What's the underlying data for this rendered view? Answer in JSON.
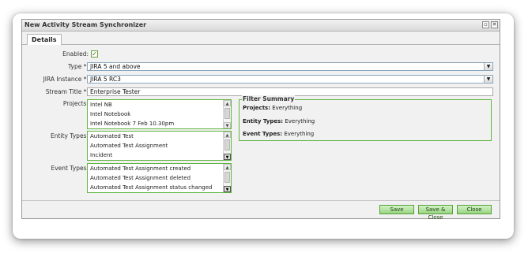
{
  "window": {
    "title": "New Activity Stream Synchronizer",
    "restore_icon": "restore-icon",
    "close_icon": "close-icon"
  },
  "tabs": [
    {
      "label": "Details",
      "active": true
    }
  ],
  "form": {
    "enabled": {
      "label": "Enabled:",
      "checked": true,
      "check_glyph": "✓"
    },
    "type": {
      "label": "Type *:",
      "value": "JIRA 5 and above"
    },
    "jira_instance": {
      "label": "JIRA Instance *:",
      "value": "JIRA 5 RC3"
    },
    "stream_title": {
      "label": "Stream Title *:",
      "value": "Enterprise Tester"
    },
    "projects": {
      "label": "Projects:",
      "items": [
        "Intel NB",
        "Intel Notebook",
        "Intel Notebook 7 Feb 10.30pm"
      ]
    },
    "entity_types": {
      "label": "Entity Types:",
      "items": [
        "Automated Test",
        "Automated Test Assignment",
        "Incident"
      ]
    },
    "event_types": {
      "label": "Event Types:",
      "items": [
        "Automated Test Assignment created",
        "Automated Test Assignment deleted",
        "Automated Test Assignment status changed"
      ]
    }
  },
  "filter_summary": {
    "legend": "Filter Summary",
    "projects_label": "Projects:",
    "projects_value": "Everything",
    "entity_types_label": "Entity Types:",
    "entity_types_value": "Everything",
    "event_types_label": "Event Types:",
    "event_types_value": "Everything"
  },
  "buttons": {
    "save": "Save",
    "save_close": "Save & Close",
    "close": "Close"
  },
  "colors": {
    "accent_green": "#5fb53f",
    "button_green": "#9ad382"
  }
}
